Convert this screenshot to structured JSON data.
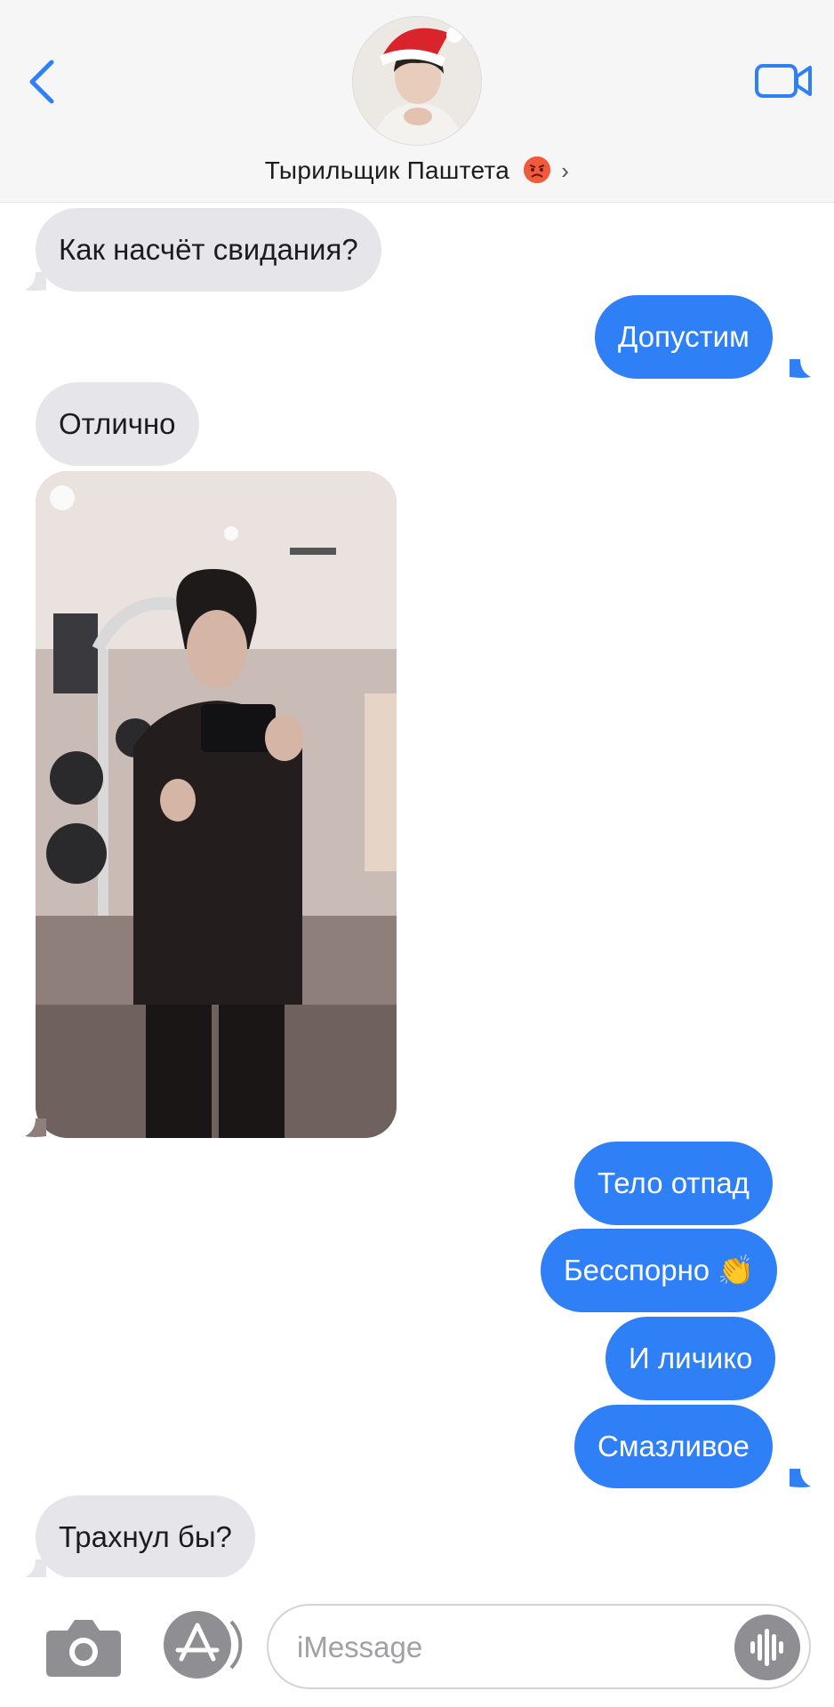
{
  "header": {
    "contact_name": "Тырильщик Паштета",
    "back_icon": "chevron-left-icon",
    "video_icon": "video-camera-icon",
    "colors": {
      "accent": "#2f80f6",
      "header_bg": "#f6f6f6"
    }
  },
  "messages": [
    {
      "side": "incoming",
      "text": "Как насчёт свидания?"
    },
    {
      "side": "outgoing",
      "text": "Допустим"
    },
    {
      "side": "incoming",
      "text": "Отлично"
    },
    {
      "side": "incoming",
      "type": "image",
      "description_icon": "photo-attachment"
    },
    {
      "side": "outgoing",
      "text": "Тело отпад"
    },
    {
      "side": "outgoing",
      "text": "Бесспорно 👏"
    },
    {
      "side": "outgoing",
      "text": "И личико"
    },
    {
      "side": "outgoing",
      "text": "Смазливое"
    },
    {
      "side": "incoming",
      "text": "Трахнул бы?"
    }
  ],
  "input_bar": {
    "placeholder": "iMessage",
    "camera_icon": "camera-icon",
    "apps_icon": "app-store-icon",
    "audio_icon": "audio-waveform-icon"
  },
  "colors": {
    "incoming_bubble": "#e5e5ea",
    "outgoing_bubble": "#2f80f6"
  }
}
